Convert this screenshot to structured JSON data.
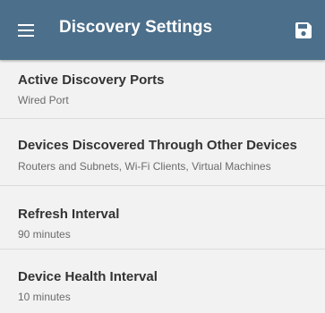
{
  "appbar": {
    "title": "Discovery Settings",
    "menu_icon": "hamburger-menu-icon",
    "save_icon": "floppy-disk-save-icon",
    "background_color": "#4c6f8b"
  },
  "settings": [
    {
      "title": "Active Discovery Ports",
      "subtitle": "Wired Port"
    },
    {
      "title": "Devices Discovered Through Other Devices",
      "subtitle": "Routers and Subnets, Wi-Fi Clients, Virtual Machines"
    },
    {
      "title": "Refresh Interval",
      "subtitle": "90 minutes"
    },
    {
      "title": "Device Health Interval",
      "subtitle": "10 minutes"
    }
  ]
}
